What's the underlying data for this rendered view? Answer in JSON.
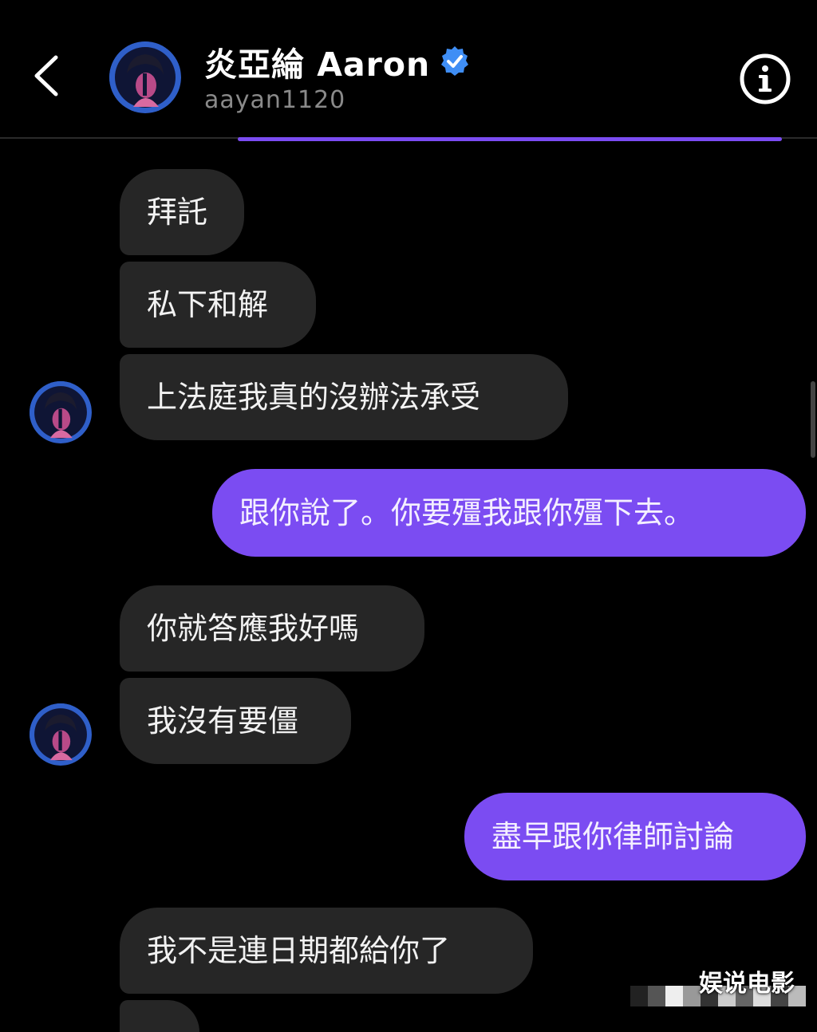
{
  "header": {
    "contact_name": "炎亞綸 Aaron",
    "handle": "aayan1120",
    "back_icon": "chevron-left-icon",
    "verified_icon": "verified-badge-icon",
    "info_icon": "info-icon",
    "accent_color": "#7b4cf2"
  },
  "messages": [
    {
      "side": "incoming",
      "text": "拜託"
    },
    {
      "side": "incoming",
      "text": "私下和解"
    },
    {
      "side": "incoming",
      "text": "上法庭我真的沒辦法承受"
    },
    {
      "side": "outgoing",
      "text": "跟你說了。你要殭我跟你殭下去。"
    },
    {
      "side": "incoming",
      "text": "你就答應我好嗎"
    },
    {
      "side": "incoming",
      "text": "我沒有要僵"
    },
    {
      "side": "outgoing",
      "text": "盡早跟你律師討論"
    },
    {
      "side": "incoming",
      "text": "我不是連日期都給你了"
    }
  ],
  "watermark": "娱说电影",
  "colors": {
    "background": "#000000",
    "incoming_bubble": "#262626",
    "outgoing_bubble": "#7b4cf2",
    "handle_text": "#8a8a8a"
  }
}
